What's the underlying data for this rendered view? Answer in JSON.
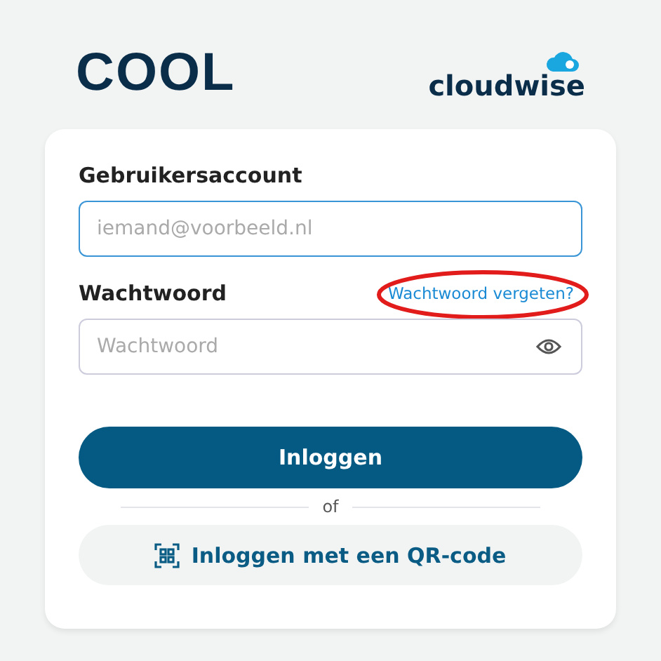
{
  "header": {
    "logo": "COOL",
    "brand": "cloudwise"
  },
  "form": {
    "username_label": "Gebruikersaccount",
    "username_placeholder": "iemand@voorbeeld.nl",
    "password_label": "Wachtwoord",
    "forgot_link": "Wachtwoord vergeten?",
    "password_placeholder": "Wachtwoord",
    "login_button": "Inloggen",
    "separator": "of",
    "qr_button": "Inloggen met een QR-code"
  }
}
